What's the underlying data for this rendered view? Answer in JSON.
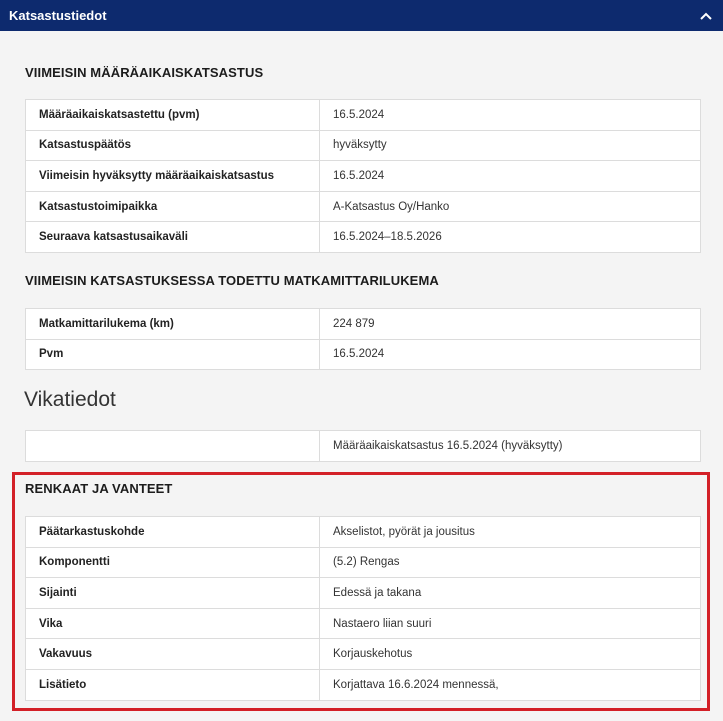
{
  "header": {
    "title": "Katsastustiedot"
  },
  "sections": {
    "latest_inspection": {
      "title": "VIIMEISIN MÄÄRÄAIKAISKATSASTUS",
      "rows": [
        {
          "label": "Määräaikaiskatsastettu (pvm)",
          "value": "16.5.2024"
        },
        {
          "label": "Katsastuspäätös",
          "value": "hyväksytty"
        },
        {
          "label": "Viimeisin hyväksytty määräaikaiskatsastus",
          "value": "16.5.2024"
        },
        {
          "label": "Katsastustoimipaikka",
          "value": "A-Katsastus Oy/Hanko"
        },
        {
          "label": "Seuraava katsastusaikaväli",
          "value": "16.5.2024–18.5.2026"
        }
      ]
    },
    "odometer": {
      "title": "VIIMEISIN KATSASTUKSESSA TODETTU MATKAMITTARILUKEMA",
      "rows": [
        {
          "label": "Matkamittarilukema (km)",
          "value": "224 879"
        },
        {
          "label": "Pvm",
          "value": "16.5.2024"
        }
      ]
    },
    "faults": {
      "title": "Vikatiedot",
      "summary": {
        "label": "",
        "value": "Määräaikaiskatsastus 16.5.2024 (hyväksytty)"
      }
    },
    "tyres": {
      "title": "RENKAAT JA VANTEET",
      "rows": [
        {
          "label": "Päätarkastuskohde",
          "value": "Akselistot, pyörät ja jousitus"
        },
        {
          "label": "Komponentti",
          "value": "(5.2) Rengas"
        },
        {
          "label": "Sijainti",
          "value": "Edessä ja takana"
        },
        {
          "label": "Vika",
          "value": "Nastaero liian suuri"
        },
        {
          "label": "Vakavuus",
          "value": "Korjauskehotus"
        },
        {
          "label": "Lisätieto",
          "value": "Korjattava 16.6.2024 mennessä,"
        }
      ]
    }
  },
  "colors": {
    "header_bg": "#0d2a6e",
    "highlight": "#d32027"
  },
  "icons": {
    "collapse": "chevron-up-icon"
  }
}
